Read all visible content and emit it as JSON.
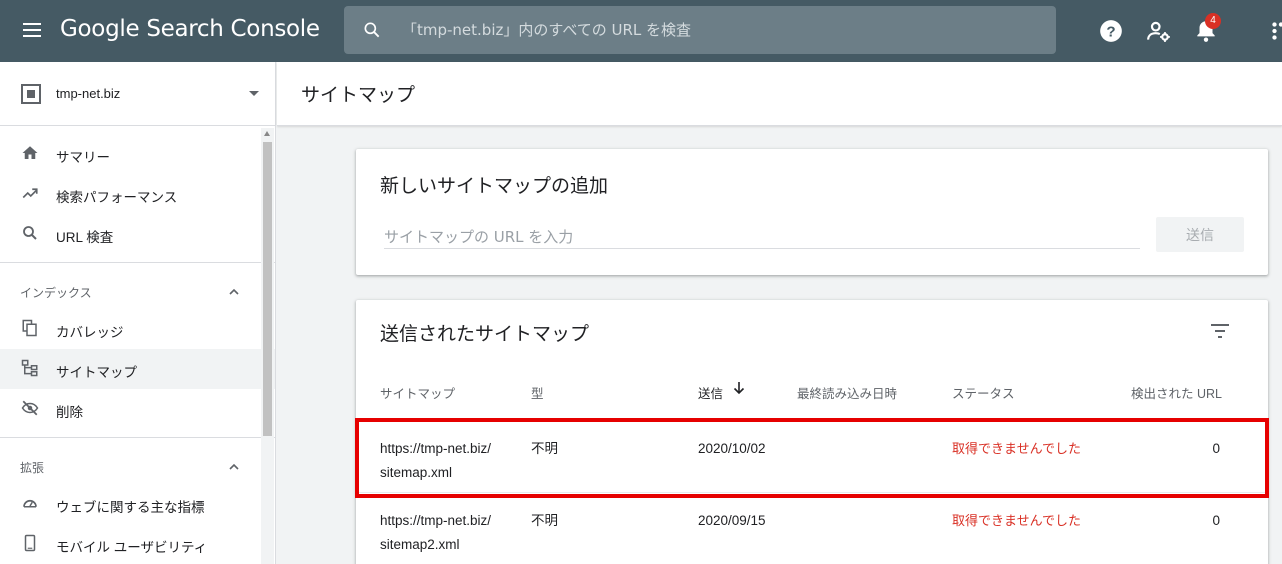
{
  "header": {
    "app_title": "Google Search Console",
    "search_placeholder": "「tmp-net.biz」内のすべての URL を検査",
    "notification_count": "4"
  },
  "sidebar": {
    "property": "tmp-net.biz",
    "items": [
      {
        "label": "サマリー",
        "icon": "home-icon"
      },
      {
        "label": "検索パフォーマンス",
        "icon": "trending-up-icon"
      },
      {
        "label": "URL 検査",
        "icon": "search-icon"
      }
    ],
    "sections": [
      {
        "title": "インデックス",
        "items": [
          {
            "label": "カバレッジ",
            "icon": "copy-icon"
          },
          {
            "label": "サイトマップ",
            "icon": "sitemap-icon",
            "active": true
          },
          {
            "label": "削除",
            "icon": "visibility-off-icon"
          }
        ]
      },
      {
        "title": "拡張",
        "items": [
          {
            "label": "ウェブに関する主な指標",
            "icon": "speed-icon"
          },
          {
            "label": "モバイル ユーザビリティ",
            "icon": "smartphone-icon"
          }
        ]
      }
    ]
  },
  "page": {
    "title": "サイトマップ"
  },
  "add_card": {
    "title": "新しいサイトマップの追加",
    "input_placeholder": "サイトマップの URL を入力",
    "submit_label": "送信"
  },
  "submitted_card": {
    "title": "送信されたサイトマップ",
    "columns": [
      "サイトマップ",
      "型",
      "送信",
      "最終読み込み日時",
      "ステータス",
      "検出された URL"
    ],
    "rows": [
      {
        "sitemap_line1": "https://tmp-net.biz/",
        "sitemap_line2": "sitemap.xml",
        "type": "不明",
        "submitted": "2020/10/02",
        "last_read": "",
        "status": "取得できませんでした",
        "urls": "0"
      },
      {
        "sitemap_line1": "https://tmp-net.biz/",
        "sitemap_line2": "sitemap2.xml",
        "type": "不明",
        "submitted": "2020/09/15",
        "last_read": "",
        "status": "取得できませんでした",
        "urls": "0"
      }
    ]
  },
  "colors": {
    "topbar": "#455a64",
    "error": "#d93025",
    "highlight": "#e60000"
  }
}
